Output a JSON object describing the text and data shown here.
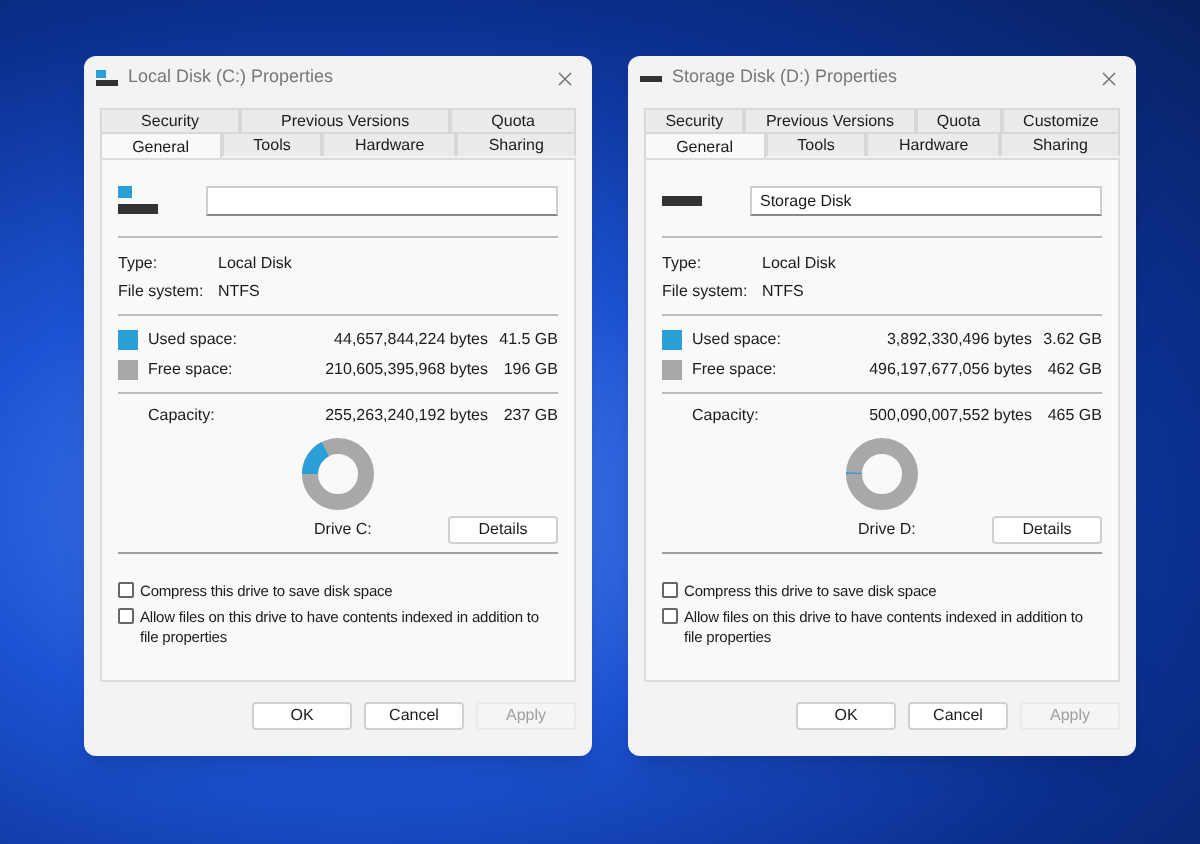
{
  "dialogs": [
    {
      "title": "Local Disk (C:) Properties",
      "kind": "system",
      "tab_rows": [
        [
          {
            "label": "Security",
            "selected": false
          },
          {
            "label": "Previous Versions",
            "selected": false
          },
          {
            "label": "Quota",
            "selected": false
          }
        ],
        [
          {
            "label": "General",
            "selected": true
          },
          {
            "label": "Tools",
            "selected": false
          },
          {
            "label": "Hardware",
            "selected": false
          },
          {
            "label": "Sharing",
            "selected": false
          }
        ]
      ],
      "type_label": "Type:",
      "type_value": "Local Disk",
      "fs_label": "File system:",
      "fs_value": "NTFS",
      "used": {
        "label": "Used space:",
        "bytes": "44,657,844,224 bytes",
        "size": "41.5 GB",
        "color": "#2a9fd8"
      },
      "free": {
        "label": "Free space:",
        "bytes": "210,605,395,968 bytes",
        "size": "196 GB",
        "color": "#a8a8a8"
      },
      "capacity": {
        "label": "Capacity:",
        "bytes": "255,263,240,192 bytes",
        "size": "237 GB"
      },
      "donut": {
        "level": 0.175
      },
      "drive_label": "Drive C:",
      "details_button": "Details",
      "options": [
        {
          "label": "Compress this drive to save disk space",
          "checked": false
        },
        {
          "label": "Allow files on this drive to have contents indexed in addition to file properties",
          "checked": false
        }
      ],
      "buttons": [
        {
          "label": "OK",
          "disabled": false
        },
        {
          "label": "Cancel",
          "disabled": false
        },
        {
          "label": "Apply",
          "disabled": true
        }
      ]
    },
    {
      "title": "Storage Disk (D:) Properties",
      "kind": "data",
      "tab_rows": [
        [
          {
            "label": "Security",
            "selected": false
          },
          {
            "label": "Previous Versions",
            "selected": false
          },
          {
            "label": "Quota",
            "selected": false
          },
          {
            "label": "Customize",
            "selected": false
          }
        ],
        [
          {
            "label": "General",
            "selected": true
          },
          {
            "label": "Tools",
            "selected": false
          },
          {
            "label": "Hardware",
            "selected": false
          },
          {
            "label": "Sharing",
            "selected": false
          }
        ]
      ],
      "name_field": {
        "value": "Storage Disk"
      },
      "type_label": "Type:",
      "type_value": "Local Disk",
      "fs_label": "File system:",
      "fs_value": "NTFS",
      "used": {
        "label": "Used space:",
        "bytes": "3,892,330,496 bytes",
        "size": "3.62 GB",
        "color": "#2a9fd8"
      },
      "free": {
        "label": "Free space:",
        "bytes": "496,197,677,056 bytes",
        "size": "462 GB",
        "color": "#a8a8a8"
      },
      "capacity": {
        "label": "Capacity:",
        "bytes": "500,090,007,552 bytes",
        "size": "465 GB"
      },
      "donut": {
        "level": 0.008
      },
      "drive_label": "Drive D:",
      "details_button": "Details",
      "options": [
        {
          "label": "Compress this drive to save disk space",
          "checked": false
        },
        {
          "label": "Allow files on this drive to have contents indexed in addition to file properties",
          "checked": false
        }
      ],
      "buttons": [
        {
          "label": "OK",
          "disabled": false
        },
        {
          "label": "Cancel",
          "disabled": false
        },
        {
          "label": "Apply",
          "disabled": true
        }
      ]
    }
  ]
}
